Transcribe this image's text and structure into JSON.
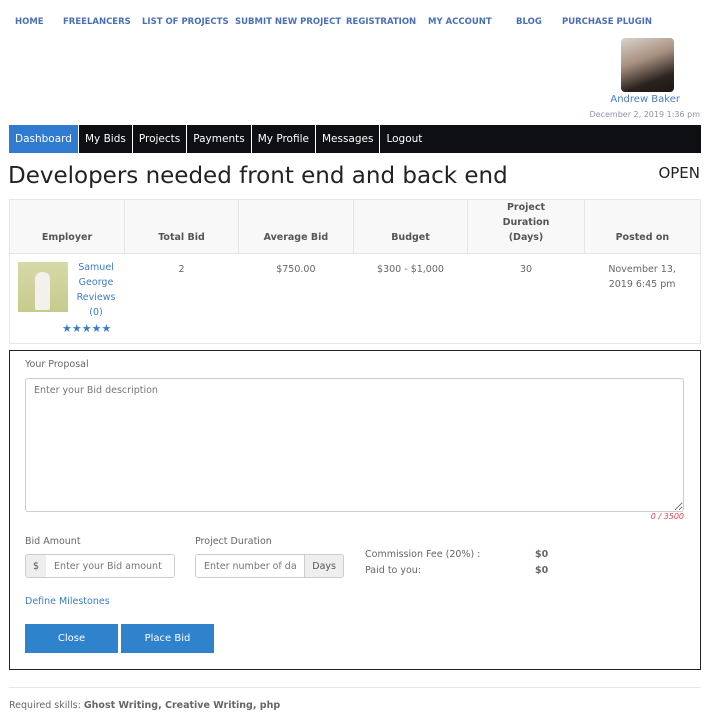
{
  "topnav": [
    "HOME",
    "FREELANCERS",
    "LIST OF PROJECTS",
    "SUBMIT NEW PROJECT",
    "REGISTRATION",
    "MY ACCOUNT",
    "BLOG",
    "PURCHASE PLUGIN"
  ],
  "user": {
    "name": "Andrew Baker",
    "date": "December 2, 2019 1:36 pm"
  },
  "tabs": [
    "Dashboard",
    "My Bids",
    "Projects",
    "Payments",
    "My Profile",
    "Messages",
    "Logout"
  ],
  "project": {
    "title": "Developers needed front end and back end",
    "status": "OPEN"
  },
  "table": {
    "headers": [
      "Employer",
      "Total Bid",
      "Average Bid",
      "Budget",
      "Project Duration (Days)",
      "Posted on"
    ],
    "row": {
      "employer": "Samuel George",
      "reviews": "Reviews (0)",
      "rating": 0,
      "total_bid": "2",
      "average_bid": "$750.00",
      "budget": "$300 - $1,000",
      "duration": "30",
      "posted": "November 13, 2019 6:45 pm"
    }
  },
  "proposal": {
    "label": "Your Proposal",
    "placeholder": "Enter your Bid description",
    "counter": "0 / 3500",
    "bid_label": "Bid Amount",
    "currency": "$",
    "bid_placeholder": "Enter your Bid amount",
    "duration_label": "Project Duration",
    "duration_placeholder": "Enter number of days",
    "duration_unit": "Days",
    "commission_label": "Commission Fee (20%) :",
    "commission_value": "$0",
    "paid_label": "Paid to you:",
    "paid_value": "$0",
    "milestones": "Define Milestones",
    "close": "Close",
    "place_bid": "Place Bid"
  },
  "skills": {
    "label": "Required skills:",
    "value": "Ghost Writing, Creative Writing, php"
  },
  "colors": {
    "accent": "#2f82cc",
    "tabbar": "#0d0f12",
    "link": "#4a6fb5"
  }
}
